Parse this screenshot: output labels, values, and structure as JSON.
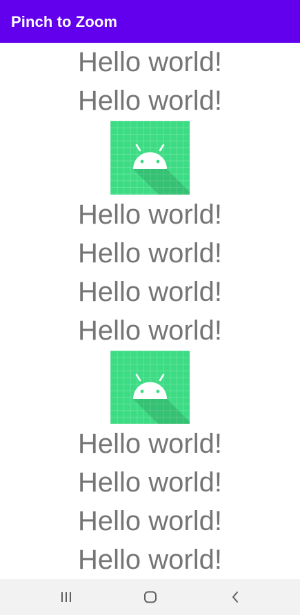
{
  "app": {
    "title": "Pinch to Zoom"
  },
  "colors": {
    "app_bar": "#6200ee",
    "text": "#757575",
    "icon_background": "#3ddc84",
    "nav_bar": "#f2f2f2"
  },
  "content": {
    "items": [
      {
        "type": "text",
        "text": "Hello world!"
      },
      {
        "type": "text",
        "text": "Hello world!"
      },
      {
        "type": "image",
        "icon": "android-launcher-icon"
      },
      {
        "type": "text",
        "text": "Hello world!"
      },
      {
        "type": "text",
        "text": "Hello world!"
      },
      {
        "type": "text",
        "text": "Hello world!"
      },
      {
        "type": "text",
        "text": "Hello world!"
      },
      {
        "type": "image",
        "icon": "android-launcher-icon"
      },
      {
        "type": "text",
        "text": "Hello world!"
      },
      {
        "type": "text",
        "text": "Hello world!"
      },
      {
        "type": "text",
        "text": "Hello world!"
      },
      {
        "type": "text",
        "text": "Hello world!"
      }
    ]
  },
  "nav": {
    "recents_icon": "recents-icon",
    "home_icon": "home-icon",
    "back_icon": "back-icon"
  }
}
